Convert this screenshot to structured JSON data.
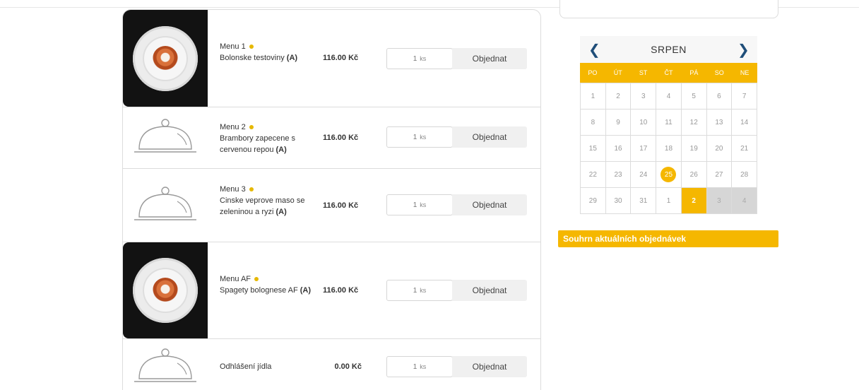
{
  "menu_items": [
    {
      "name": "Menu 1",
      "description": "Bolonske testoviny",
      "allergen": "(A)",
      "price": "116.00 Kč",
      "qty": "1",
      "unit": "ks",
      "button": "Objednat",
      "has_photo": true
    },
    {
      "name": "Menu 2",
      "description": "Brambory zapecene s cervenou repou",
      "allergen": "(A)",
      "price": "116.00 Kč",
      "qty": "1",
      "unit": "ks",
      "button": "Objednat",
      "has_photo": false
    },
    {
      "name": "Menu 3",
      "description": "Cinske veprove maso se zeleninou a ryzi",
      "allergen": "(A)",
      "price": "116.00 Kč",
      "qty": "1",
      "unit": "ks",
      "button": "Objednat",
      "has_photo": false
    },
    {
      "name": "Menu AF",
      "description": "Spagety bolognese AF",
      "allergen": "(A)",
      "price": "116.00 Kč",
      "qty": "1",
      "unit": "ks",
      "button": "Objednat",
      "has_photo": true
    },
    {
      "name": "Odhlášení jídla",
      "description": "",
      "allergen": "",
      "price": "0.00 Kč",
      "qty": "1",
      "unit": "ks",
      "button": "Objednat",
      "has_photo": false
    }
  ],
  "calendar": {
    "month": "SRPEN",
    "weekdays": [
      "PO",
      "ÚT",
      "ST",
      "ČT",
      "PÁ",
      "SO",
      "NE"
    ],
    "days": [
      [
        "1",
        "2",
        "3",
        "4",
        "5",
        "6",
        "7"
      ],
      [
        "8",
        "9",
        "10",
        "11",
        "12",
        "13",
        "14"
      ],
      [
        "15",
        "16",
        "17",
        "18",
        "19",
        "20",
        "21"
      ],
      [
        "22",
        "23",
        "24",
        "25",
        "26",
        "27",
        "28"
      ],
      [
        "29",
        "30",
        "31",
        "1",
        "2",
        "3",
        "4"
      ]
    ],
    "today": "25",
    "selected": "2",
    "accent_color": "#f5b700",
    "nav_color": "#1f4e79"
  },
  "summary": {
    "label": "Souhrn aktuálních objednávek"
  }
}
